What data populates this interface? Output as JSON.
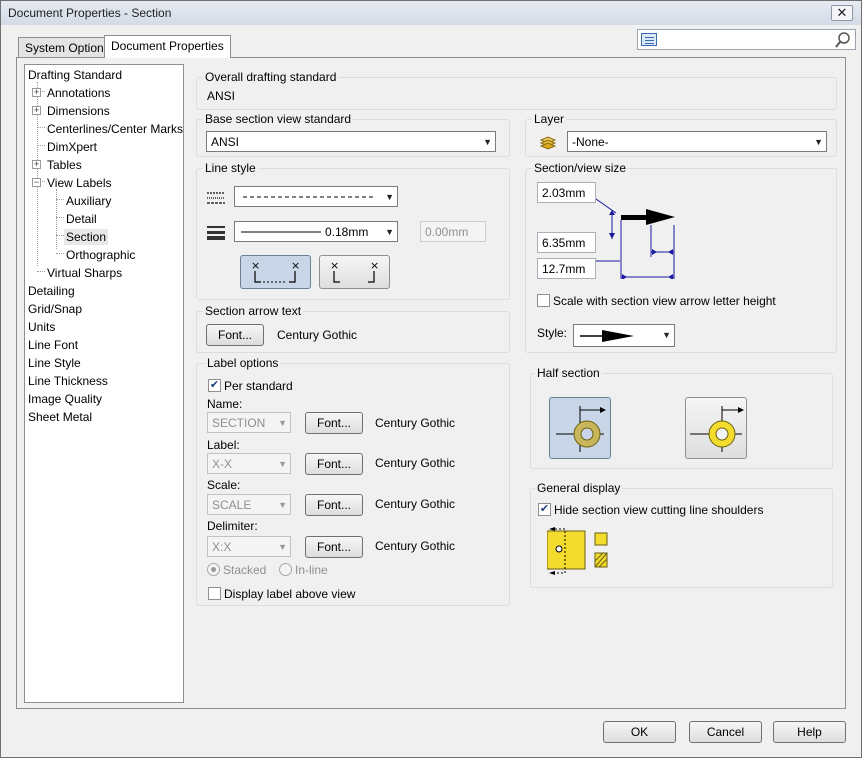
{
  "window": {
    "title": "Document Properties - Section",
    "close_label": "✕"
  },
  "tabs": [
    {
      "label": "System Options"
    },
    {
      "label": "Document Properties"
    }
  ],
  "search": {
    "value": "",
    "placeholder": ""
  },
  "tree": {
    "items": [
      {
        "label": "Drafting Standard"
      },
      {
        "label": "Annotations"
      },
      {
        "label": "Dimensions"
      },
      {
        "label": "Centerlines/Center Marks"
      },
      {
        "label": "DimXpert"
      },
      {
        "label": "Tables"
      },
      {
        "label": "View Labels"
      },
      {
        "label": "Auxiliary"
      },
      {
        "label": "Detail"
      },
      {
        "label": "Section"
      },
      {
        "label": "Orthographic"
      },
      {
        "label": "Virtual Sharps"
      },
      {
        "label": "Detailing"
      },
      {
        "label": "Grid/Snap"
      },
      {
        "label": "Units"
      },
      {
        "label": "Line Font"
      },
      {
        "label": "Line Style"
      },
      {
        "label": "Line Thickness"
      },
      {
        "label": "Image Quality"
      },
      {
        "label": "Sheet Metal"
      }
    ],
    "selected": "Section"
  },
  "overall": {
    "label": "Overall drafting standard",
    "value": "ANSI"
  },
  "base_section": {
    "label": "Base section view standard",
    "value": "ANSI"
  },
  "layer": {
    "label": "Layer",
    "value": "-None-"
  },
  "line_style": {
    "label": "Line style",
    "thickness_value": "0.18mm",
    "custom_thickness": "0.00mm"
  },
  "section_view_size": {
    "label": "Section/view size",
    "arrow_head": "2.03mm",
    "arrow_length": "6.35mm",
    "arrow_offset": "12.7mm",
    "scale_checkbox": "Scale with section view arrow letter height",
    "scale_checked": false,
    "style_label": "Style:"
  },
  "section_arrow_text": {
    "label": "Section arrow text",
    "font_button": "Font...",
    "font_name": "Century Gothic"
  },
  "label_options": {
    "label": "Label options",
    "per_standard": "Per standard",
    "per_standard_checked": true,
    "rows": [
      {
        "caption": "Name:",
        "value": "SECTION",
        "font_button": "Font...",
        "font_name": "Century Gothic"
      },
      {
        "caption": "Label:",
        "value": "X-X",
        "font_button": "Font...",
        "font_name": "Century Gothic"
      },
      {
        "caption": "Scale:",
        "value": "SCALE",
        "font_button": "Font...",
        "font_name": "Century Gothic"
      },
      {
        "caption": "Delimiter:",
        "value": "X:X",
        "font_button": "Font...",
        "font_name": "Century Gothic"
      }
    ],
    "stacked": "Stacked",
    "inline": "In-line",
    "display_above": "Display label above view",
    "display_above_checked": false
  },
  "half_section": {
    "label": "Half section"
  },
  "general_display": {
    "label": "General display",
    "hide_shoulders": "Hide section view cutting line shoulders",
    "hide_shoulders_checked": true
  },
  "footer": {
    "ok": "OK",
    "cancel": "Cancel",
    "help": "Help"
  }
}
